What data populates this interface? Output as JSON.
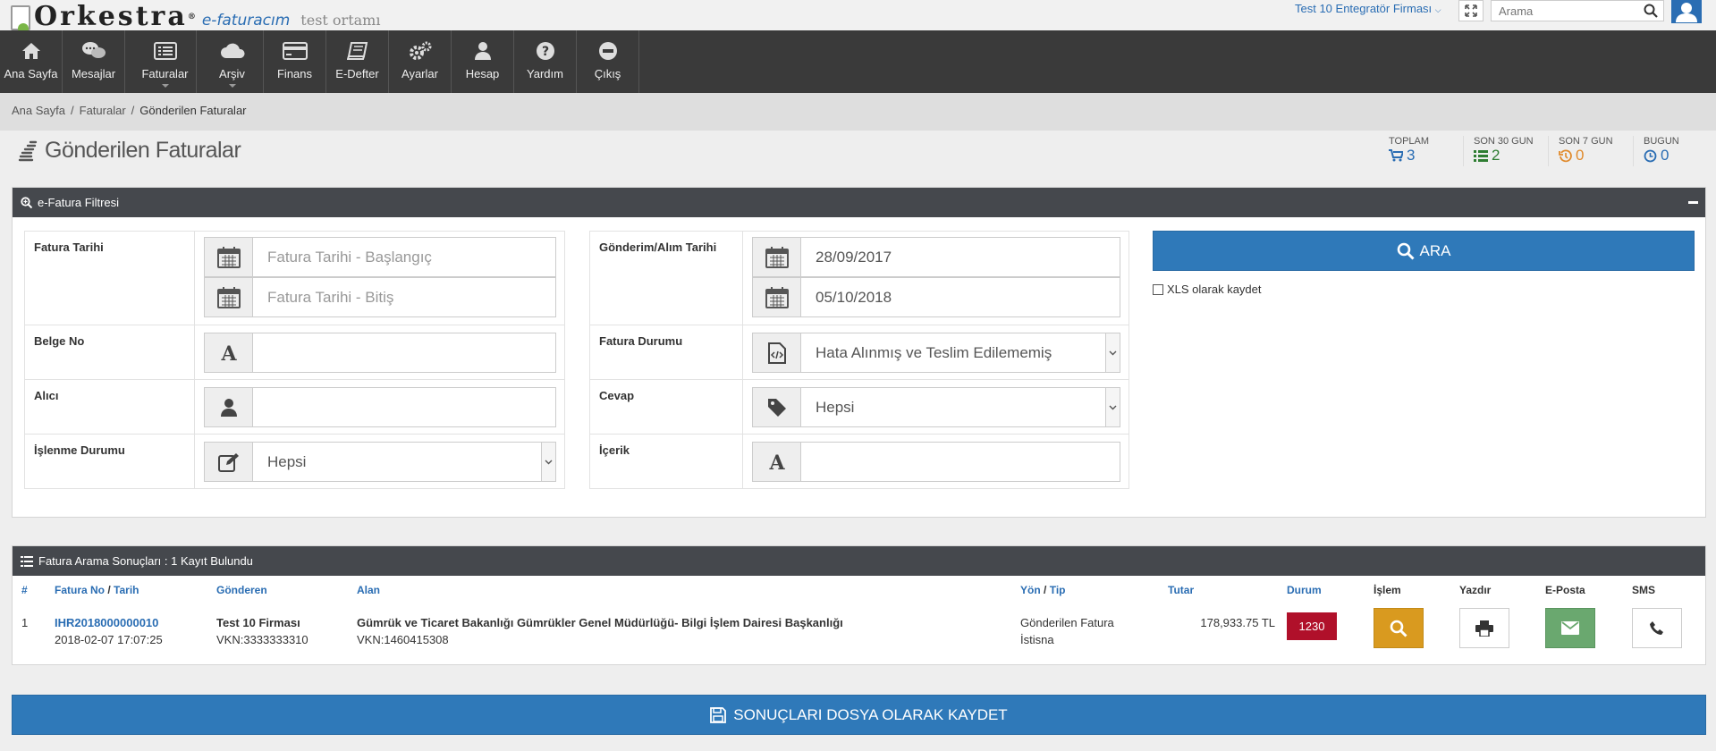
{
  "header": {
    "logo_text": "Orkestra",
    "logo_reg": "®",
    "logo_sub": "e-faturacım",
    "environment": "test ortamı",
    "company": "Test 10 Entegratör Firması",
    "search_placeholder": "Arama"
  },
  "nav": [
    {
      "label": "Ana Sayfa",
      "icon": "home-icon"
    },
    {
      "label": "Mesajlar",
      "icon": "chat-icon"
    },
    {
      "label": "Faturalar",
      "icon": "invoice-list-icon"
    },
    {
      "label": "Arşiv",
      "icon": "cloud-icon"
    },
    {
      "label": "Finans",
      "icon": "credit-card-icon"
    },
    {
      "label": "E-Defter",
      "icon": "book-icon"
    },
    {
      "label": "Ayarlar",
      "icon": "gears-icon"
    },
    {
      "label": "Hesap",
      "icon": "user-icon"
    },
    {
      "label": "Yardım",
      "icon": "question-icon"
    },
    {
      "label": "Çıkış",
      "icon": "minus-circle-icon"
    }
  ],
  "breadcrumb": {
    "home": "Ana Sayfa",
    "section": "Faturalar",
    "current": "Gönderilen Faturalar",
    "sep": "/"
  },
  "page": {
    "title": "Gönderilen Faturalar"
  },
  "stats": [
    {
      "label": "TOPLAM",
      "value": "3",
      "color": "#2a6db3",
      "icon": "cart-icon"
    },
    {
      "label": "SON 30 GUN",
      "value": "2",
      "color": "#2e7d32",
      "icon": "list-icon"
    },
    {
      "label": "SON 7 GUN",
      "value": "0",
      "color": "#e08a2c",
      "icon": "history-icon"
    },
    {
      "label": "BUGUN",
      "value": "0",
      "color": "#2a6db3",
      "icon": "clock-icon"
    }
  ],
  "filter": {
    "title": "e-Fatura Filtresi",
    "fatura_tarihi_label": "Fatura Tarihi",
    "fatura_tarihi_start_ph": "Fatura Tarihi - Başlangıç",
    "fatura_tarihi_end_ph": "Fatura Tarihi - Bitiş",
    "belge_no_label": "Belge No",
    "belge_no_value": "",
    "alici_label": "Alıcı",
    "alici_value": "",
    "islenme_label": "İşlenme Durumu",
    "islenme_value": "Hepsi",
    "gonderim_label": "Gönderim/Alım Tarihi",
    "gonderim_start": "28/09/2017",
    "gonderim_end": "05/10/2018",
    "durum_label": "Fatura Durumu",
    "durum_value": "Hata Alınmış ve Teslim Edilememiş",
    "cevap_label": "Cevap",
    "cevap_value": "Hepsi",
    "icerik_label": "İçerik",
    "icerik_value": "",
    "search_button": "ARA",
    "xls_label": "XLS olarak kaydet"
  },
  "results": {
    "title": "Fatura Arama Sonuçları : 1 Kayıt Bulundu",
    "headers": {
      "num": "#",
      "fatura_no": "Fatura No",
      "slash": "/",
      "tarih": "Tarih",
      "gonderen": "Gönderen",
      "alan": "Alan",
      "yon": "Yön",
      "tip": "Tip",
      "tutar": "Tutar",
      "durum": "Durum",
      "islem": "İşlem",
      "yazdir": "Yazdır",
      "eposta": "E-Posta",
      "sms": "SMS"
    },
    "rows": [
      {
        "num": "1",
        "fatura_no": "IHR2018000000010",
        "tarih": "2018-02-07 17:07:25",
        "gonderen": "Test 10 Firması",
        "gonderen_vkn": "VKN:3333333310",
        "alan": "Gümrük ve Ticaret Bakanlığı Gümrükler Genel Müdürlüğü- Bilgi İşlem Dairesi Başkanlığı",
        "alan_vkn": "VKN:1460415308",
        "yon": "Gönderilen Fatura",
        "tip": "İstisna",
        "tutar": "178,933.75 TL",
        "durum": "1230"
      }
    ],
    "colors": {
      "durum_badge": "#b0102a",
      "islem_btn": "#d99a1f",
      "eposta_btn": "#6aa86f"
    }
  },
  "save_button": "SONUÇLARI DOSYA OLARAK KAYDET"
}
